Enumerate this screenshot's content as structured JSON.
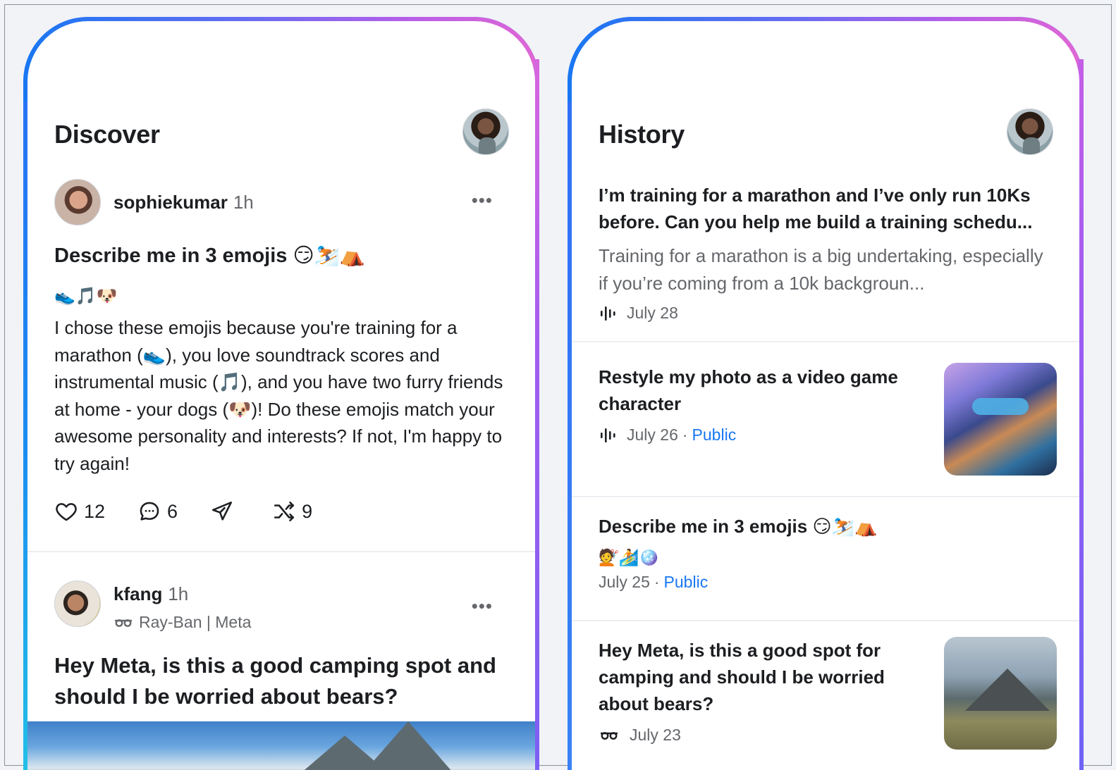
{
  "discover": {
    "title": "Discover",
    "post1": {
      "username": "sophiekumar",
      "time": "1h",
      "more": "•••",
      "title": "Describe me in 3 emojis 😏⛷️⛺",
      "emojis": "👟🎵🐶",
      "body": "I chose these emojis because you're training for a marathon (👟), you love soundtrack scores and instrumental music (🎵), and you have two furry friends at home - your dogs (🐶)! Do these emojis match your awesome personality and interests? If not, I'm happy to try again!",
      "likes": "12",
      "comments": "6",
      "remixes": "9"
    },
    "post2": {
      "username": "kfang",
      "time": "1h",
      "more": "•••",
      "device": "Ray-Ban | Meta",
      "title": "Hey Meta, is this a good camping spot and should I be worried about bears?"
    }
  },
  "history": {
    "title": "History",
    "items": [
      {
        "question": "I’m training for a marathon and I’ve only run 10Ks before. Can you help me build a training schedu...",
        "answer": "Training for a marathon is a big undertaking, especially if you’re coming from a 10k backgroun...",
        "date": "July 28"
      },
      {
        "question": "Restyle my photo as a video game character",
        "date": "July 26",
        "visibility": "Public"
      },
      {
        "question": "Describe me in 3 emojis 😏⛷️⛺",
        "emojis": "💇🏄🪩",
        "date": "July 25",
        "visibility": "Public"
      },
      {
        "question": "Hey Meta, is this a good spot for camping and should I be worried about bears?",
        "date": "July 23"
      }
    ]
  },
  "icons": {
    "like": "heart-icon",
    "comment": "comment-icon",
    "share": "send-icon",
    "remix": "shuffle-icon",
    "voice": "voice-waveform-icon",
    "glasses": "glasses-icon"
  },
  "colors": {
    "accent": "#1877f2",
    "frame_blue": "#1877f2",
    "frame_pink": "#e065d6",
    "secondary_text": "#65676b"
  }
}
